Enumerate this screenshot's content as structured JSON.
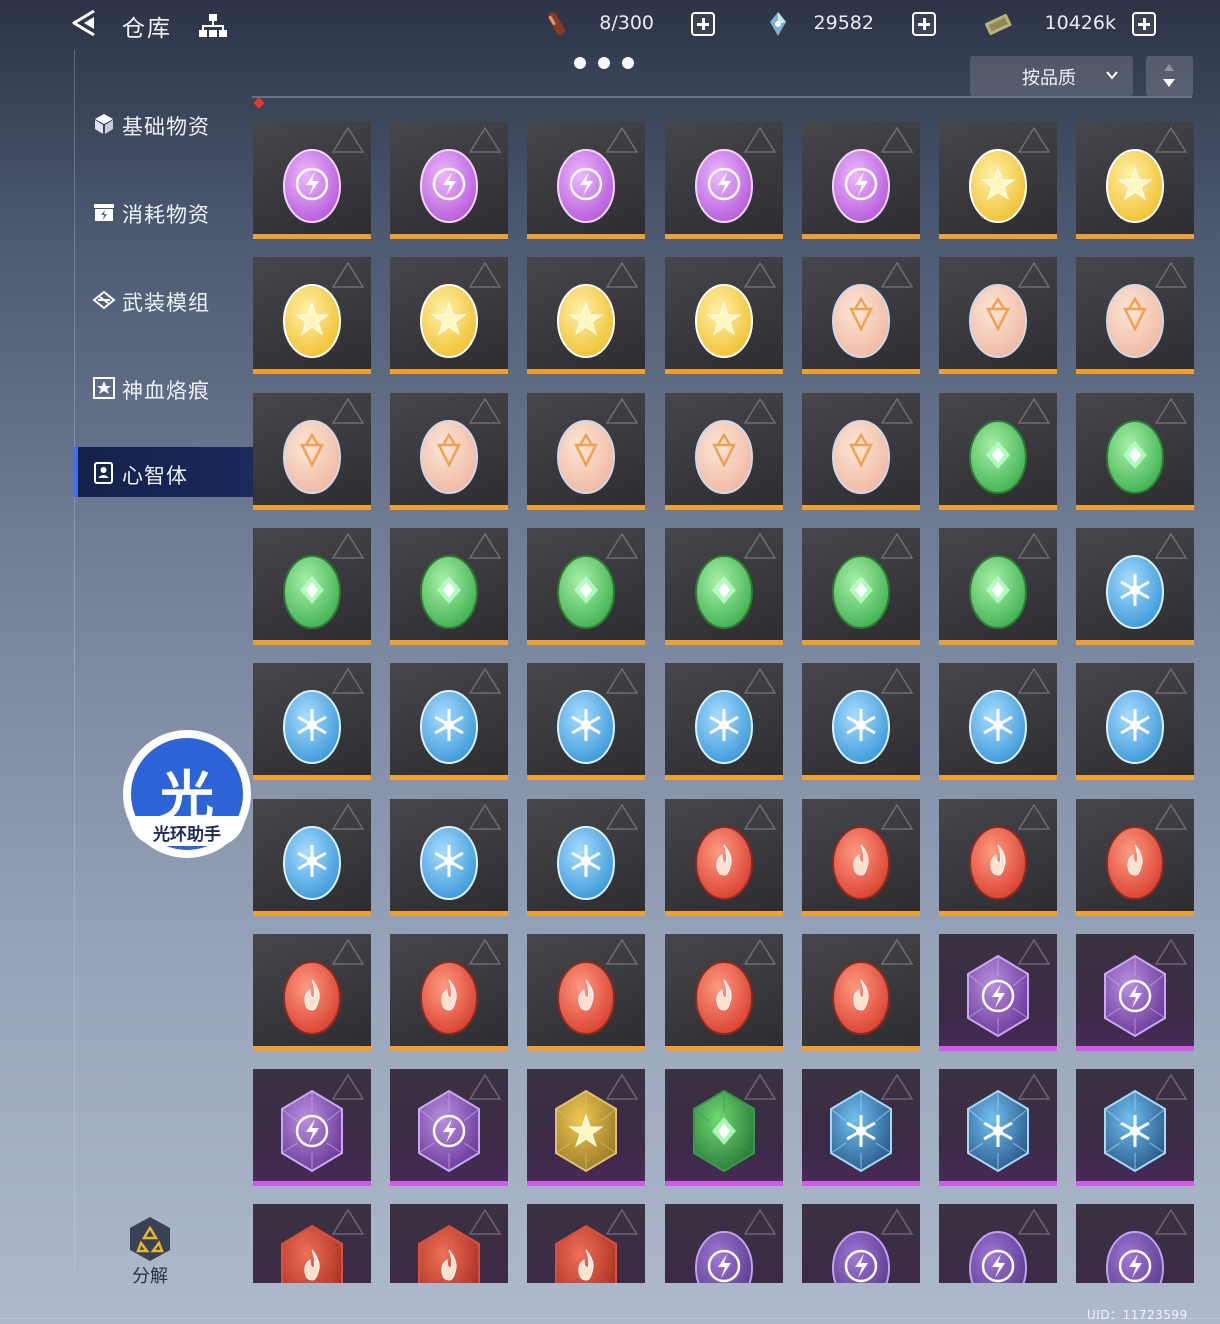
{
  "header": {
    "title": "仓库",
    "capacity": "8/300",
    "crystals": "29582",
    "currency": "10426k"
  },
  "sort": {
    "label": "按品质"
  },
  "sidebar": {
    "items": [
      {
        "label": "基础物资",
        "icon": "cube-icon"
      },
      {
        "label": "消耗物资",
        "icon": "supply-box-icon"
      },
      {
        "label": "武装模组",
        "icon": "armament-icon"
      },
      {
        "label": "神血烙痕",
        "icon": "star-seal-icon"
      },
      {
        "label": "心智体",
        "icon": "mind-icon",
        "active": true
      }
    ]
  },
  "colors": {
    "orange_rarity": "#f0a030",
    "purple_rarity": "#d25ae8",
    "active_tab": "#18285a",
    "accent_blue": "#3f6ff0"
  },
  "grid": {
    "columns": 7,
    "rows": [
      [
        "purple-orb",
        "purple-orb",
        "purple-orb",
        "purple-orb",
        "purple-orb",
        "gold-star",
        "gold-star"
      ],
      [
        "gold-star",
        "gold-star",
        "gold-star",
        "gold-star",
        "peach-crystal",
        "peach-crystal",
        "peach-crystal"
      ],
      [
        "peach-crystal",
        "peach-crystal",
        "peach-crystal",
        "peach-crystal",
        "peach-crystal",
        "green-leaf",
        "green-leaf"
      ],
      [
        "green-leaf",
        "green-leaf",
        "green-leaf",
        "green-leaf",
        "green-leaf",
        "green-leaf",
        "blue-ice"
      ],
      [
        "blue-ice",
        "blue-ice",
        "blue-ice",
        "blue-ice",
        "blue-ice",
        "blue-ice",
        "blue-ice"
      ],
      [
        "blue-ice",
        "blue-ice",
        "blue-ice",
        "red-fire",
        "red-fire",
        "red-fire",
        "red-fire"
      ],
      [
        "red-fire",
        "red-fire",
        "red-fire",
        "red-fire",
        "red-fire",
        "purple-hex",
        "purple-hex"
      ],
      [
        "purple-hex",
        "purple-hex",
        "gold-hex",
        "green-hex",
        "blue-hex",
        "blue-hex",
        "blue-hex"
      ],
      [
        "red-hex",
        "red-hex",
        "red-hex",
        "violet-rune",
        "violet-rune",
        "violet-rune",
        "violet-rune"
      ]
    ],
    "rarity": [
      [
        "orange",
        "orange",
        "orange",
        "orange",
        "orange",
        "orange",
        "orange"
      ],
      [
        "orange",
        "orange",
        "orange",
        "orange",
        "orange",
        "orange",
        "orange"
      ],
      [
        "orange",
        "orange",
        "orange",
        "orange",
        "orange",
        "orange",
        "orange"
      ],
      [
        "orange",
        "orange",
        "orange",
        "orange",
        "orange",
        "orange",
        "orange"
      ],
      [
        "orange",
        "orange",
        "orange",
        "orange",
        "orange",
        "orange",
        "orange"
      ],
      [
        "orange",
        "orange",
        "orange",
        "orange",
        "orange",
        "orange",
        "orange"
      ],
      [
        "orange",
        "orange",
        "orange",
        "orange",
        "orange",
        "purple",
        "purple"
      ],
      [
        "purple",
        "purple",
        "purple",
        "purple",
        "purple",
        "purple",
        "purple"
      ],
      [
        "purple",
        "purple",
        "purple",
        "purple",
        "purple",
        "purple",
        "purple"
      ]
    ]
  },
  "badge": {
    "glyph": "光",
    "label": "光环助手"
  },
  "decompose": {
    "label": "分解"
  },
  "footer": {
    "uid": "UID：11723599"
  }
}
